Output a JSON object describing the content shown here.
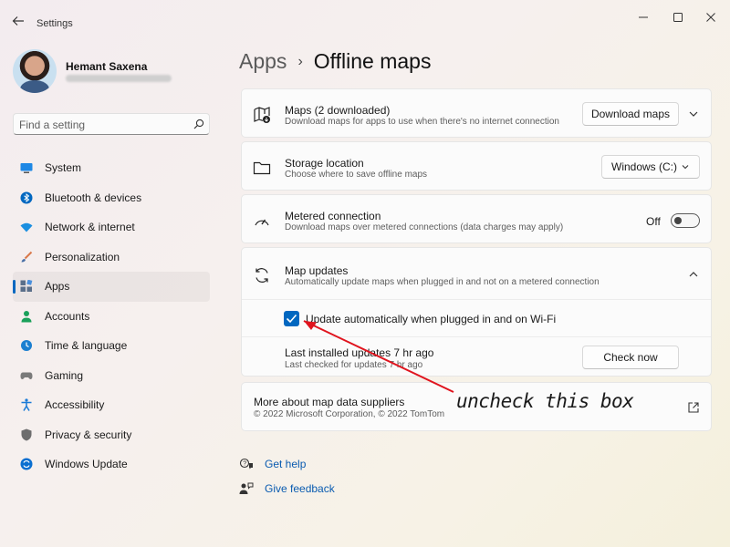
{
  "titlebar": {
    "back_icon": "back-arrow-icon",
    "title": "Settings",
    "minimize_icon": "minimize-icon",
    "maximize_icon": "maximize-icon",
    "close_icon": "close-icon"
  },
  "profile": {
    "name": "Hemant Saxena"
  },
  "search": {
    "placeholder": "Find a setting"
  },
  "sidebar": {
    "items": [
      {
        "label": "System",
        "icon": "monitor-icon",
        "color": "#0078d4"
      },
      {
        "label": "Bluetooth & devices",
        "icon": "bluetooth-icon",
        "color": "#0067c0"
      },
      {
        "label": "Network & internet",
        "icon": "wifi-icon",
        "color": "#1b8fe0"
      },
      {
        "label": "Personalization",
        "icon": "brush-icon",
        "color": "#d9784a"
      },
      {
        "label": "Apps",
        "icon": "apps-icon",
        "color": "#5a6f8a"
      },
      {
        "label": "Accounts",
        "icon": "person-icon",
        "color": "#1aa05a"
      },
      {
        "label": "Time & language",
        "icon": "clock-globe-icon",
        "color": "#1b7fd0"
      },
      {
        "label": "Gaming",
        "icon": "controller-icon",
        "color": "#7a7a7a"
      },
      {
        "label": "Accessibility",
        "icon": "accessibility-icon",
        "color": "#1a7ad6"
      },
      {
        "label": "Privacy & security",
        "icon": "shield-icon",
        "color": "#6d6d6d"
      },
      {
        "label": "Windows Update",
        "icon": "update-icon",
        "color": "#0a6fd0"
      }
    ],
    "active_index": 4
  },
  "breadcrumb": {
    "parent": "Apps",
    "separator": "›",
    "current": "Offline maps"
  },
  "cards": {
    "maps": {
      "title": "Maps (2 downloaded)",
      "desc": "Download maps for apps to use when there's no internet connection",
      "button": "Download maps",
      "icon": "map-download-icon"
    },
    "storage": {
      "title": "Storage location",
      "desc": "Choose where to save offline maps",
      "dropdown_value": "Windows (C:)",
      "icon": "folder-icon"
    },
    "metered": {
      "title": "Metered connection",
      "desc": "Download maps over metered connections (data charges may apply)",
      "toggle_state": "Off",
      "icon": "gauge-icon"
    },
    "updates": {
      "title": "Map updates",
      "desc": "Automatically update maps when plugged in and not on a metered connection",
      "icon": "sync-icon",
      "checkbox_label": "Update automatically when plugged in and on Wi-Fi",
      "checkbox_checked": true,
      "last_installed": "Last installed updates 7 hr ago",
      "last_checked": "Last checked for updates 7 hr ago",
      "button": "Check now"
    },
    "suppliers": {
      "title": "More about map data suppliers",
      "desc": "© 2022 Microsoft Corporation, © 2022 TomTom",
      "icon": "open-external-icon"
    }
  },
  "help": {
    "get_help": "Get help",
    "give_feedback": "Give feedback"
  },
  "annotation": {
    "text": "uncheck this box",
    "color": "#e0141e"
  },
  "colors": {
    "accent": "#0067c0"
  }
}
